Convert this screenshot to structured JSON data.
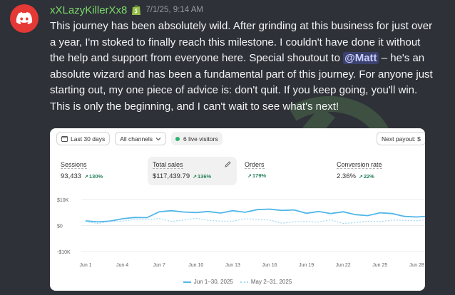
{
  "post": {
    "username": "xXLazyKillerXx8",
    "timestamp": "7/1/25, 9:14 AM",
    "message_part1": "This journey has been absolutely wild. After grinding at this business for just over a year, I'm stoked to finally reach this milestone. I couldn't have done it without the help and support from everyone here. Special shoutout to ",
    "mention": "@Matt",
    "message_part2": " – he's an absolute wizard and has been a fundamental part of this journey. For anyone just starting out, my one piece of advice is: don't quit. If you keep going, you'll win. This is only the beginning, and I can't wait to see what's next!",
    "avatar_icon": "discord-logo-icon",
    "badge_icon": "shopify-bag-icon",
    "avatar_color": "#e53935",
    "username_color": "#79d96b"
  },
  "dashboard": {
    "toolbar": {
      "date_range": "Last 30 days",
      "channels": "All channels",
      "live_visitors": "6 live visitors",
      "payout": "Next payout: $"
    },
    "metrics": [
      {
        "label": "Sessions",
        "value": "93,433",
        "delta": "130%"
      },
      {
        "label": "Total sales",
        "value": "$117,439.79",
        "delta": "136%"
      },
      {
        "label": "Orders",
        "value": "",
        "delta": "179%"
      },
      {
        "label": "Conversion rate",
        "value": "2.36%",
        "delta": "22%"
      }
    ],
    "legend": {
      "current": "Jun 1–30, 2025",
      "previous": "May 2–31, 2025"
    }
  },
  "chart_data": {
    "type": "line",
    "x": [
      "Jun 1",
      "Jun 2",
      "Jun 3",
      "Jun 4",
      "Jun 5",
      "Jun 6",
      "Jun 7",
      "Jun 8",
      "Jun 9",
      "Jun 10",
      "Jun 11",
      "Jun 12",
      "Jun 13",
      "Jun 14",
      "Jun 15",
      "Jun 16",
      "Jun 17",
      "Jun 18",
      "Jun 19",
      "Jun 20",
      "Jun 21",
      "Jun 22",
      "Jun 23",
      "Jun 24",
      "Jun 25",
      "Jun 26",
      "Jun 27",
      "Jun 28",
      "Jun 29",
      "Jun 30"
    ],
    "tick_labels": [
      "Jun 1",
      "Jun 4",
      "Jun 7",
      "Jun 10",
      "Jun 13",
      "Jun 16",
      "Jun 19",
      "Jun 22",
      "Jun 25",
      "Jun 28"
    ],
    "y_tick_labels": [
      "$10K",
      "$0",
      "-$10K"
    ],
    "ylim": [
      -10000,
      10000
    ],
    "series": [
      {
        "name": "Jun 1–30, 2025",
        "color": "#52b6e8",
        "style": "solid",
        "values": [
          1800,
          1400,
          1700,
          2600,
          3100,
          3000,
          5300,
          5700,
          5200,
          5000,
          5400,
          4800,
          5700,
          5100,
          6100,
          6300,
          5800,
          6000,
          4700,
          5400,
          4600,
          5300,
          4200,
          3800,
          4900,
          4600,
          3500,
          3300,
          3600,
          3900
        ]
      },
      {
        "name": "May 2–31, 2025",
        "color": "#9fd6f2",
        "style": "dotted",
        "values": [
          1500,
          800,
          1600,
          1700,
          2300,
          2200,
          2700,
          1600,
          2100,
          2800,
          2000,
          1700,
          1700,
          2600,
          2400,
          2100,
          900,
          1400,
          1600,
          1300,
          2200,
          800,
          1100,
          1700,
          1500,
          2100,
          2000,
          1800,
          2400,
          1600
        ]
      }
    ],
    "grid": true
  }
}
